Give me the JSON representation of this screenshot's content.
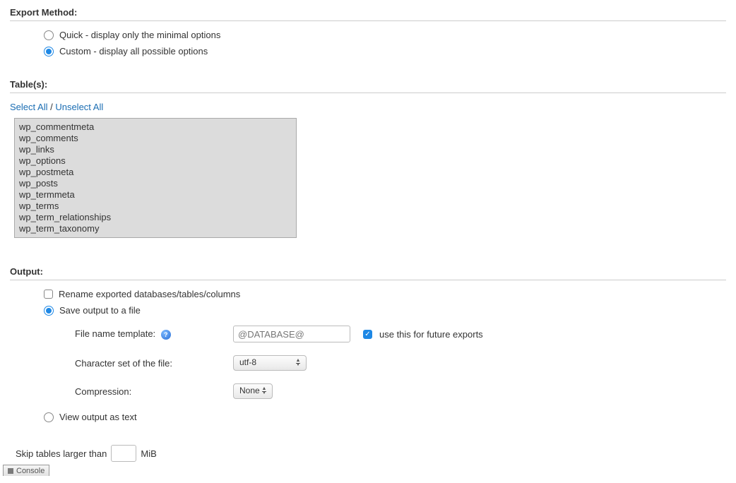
{
  "exportMethod": {
    "title": "Export Method:",
    "quick": "Quick - display only the minimal options",
    "custom": "Custom - display all possible options"
  },
  "tables": {
    "title": "Table(s):",
    "selectAll": "Select All",
    "sep": " / ",
    "unselectAll": "Unselect All",
    "items": [
      "wp_commentmeta",
      "wp_comments",
      "wp_links",
      "wp_options",
      "wp_postmeta",
      "wp_posts",
      "wp_termmeta",
      "wp_terms",
      "wp_term_relationships",
      "wp_term_taxonomy"
    ]
  },
  "output": {
    "title": "Output:",
    "rename": "Rename exported databases/tables/columns",
    "saveToFile": "Save output to a file",
    "filenameLabel": "File name template:",
    "filenameValue": "@DATABASE@",
    "useFuture": "use this for future exports",
    "charsetLabel": "Character set of the file:",
    "charsetValue": "utf-8",
    "compressionLabel": "Compression:",
    "compressionValue": "None",
    "viewAsText": "View output as text",
    "skipPrefix": "Skip tables larger than",
    "skipSuffix": "MiB"
  },
  "console": "Console"
}
